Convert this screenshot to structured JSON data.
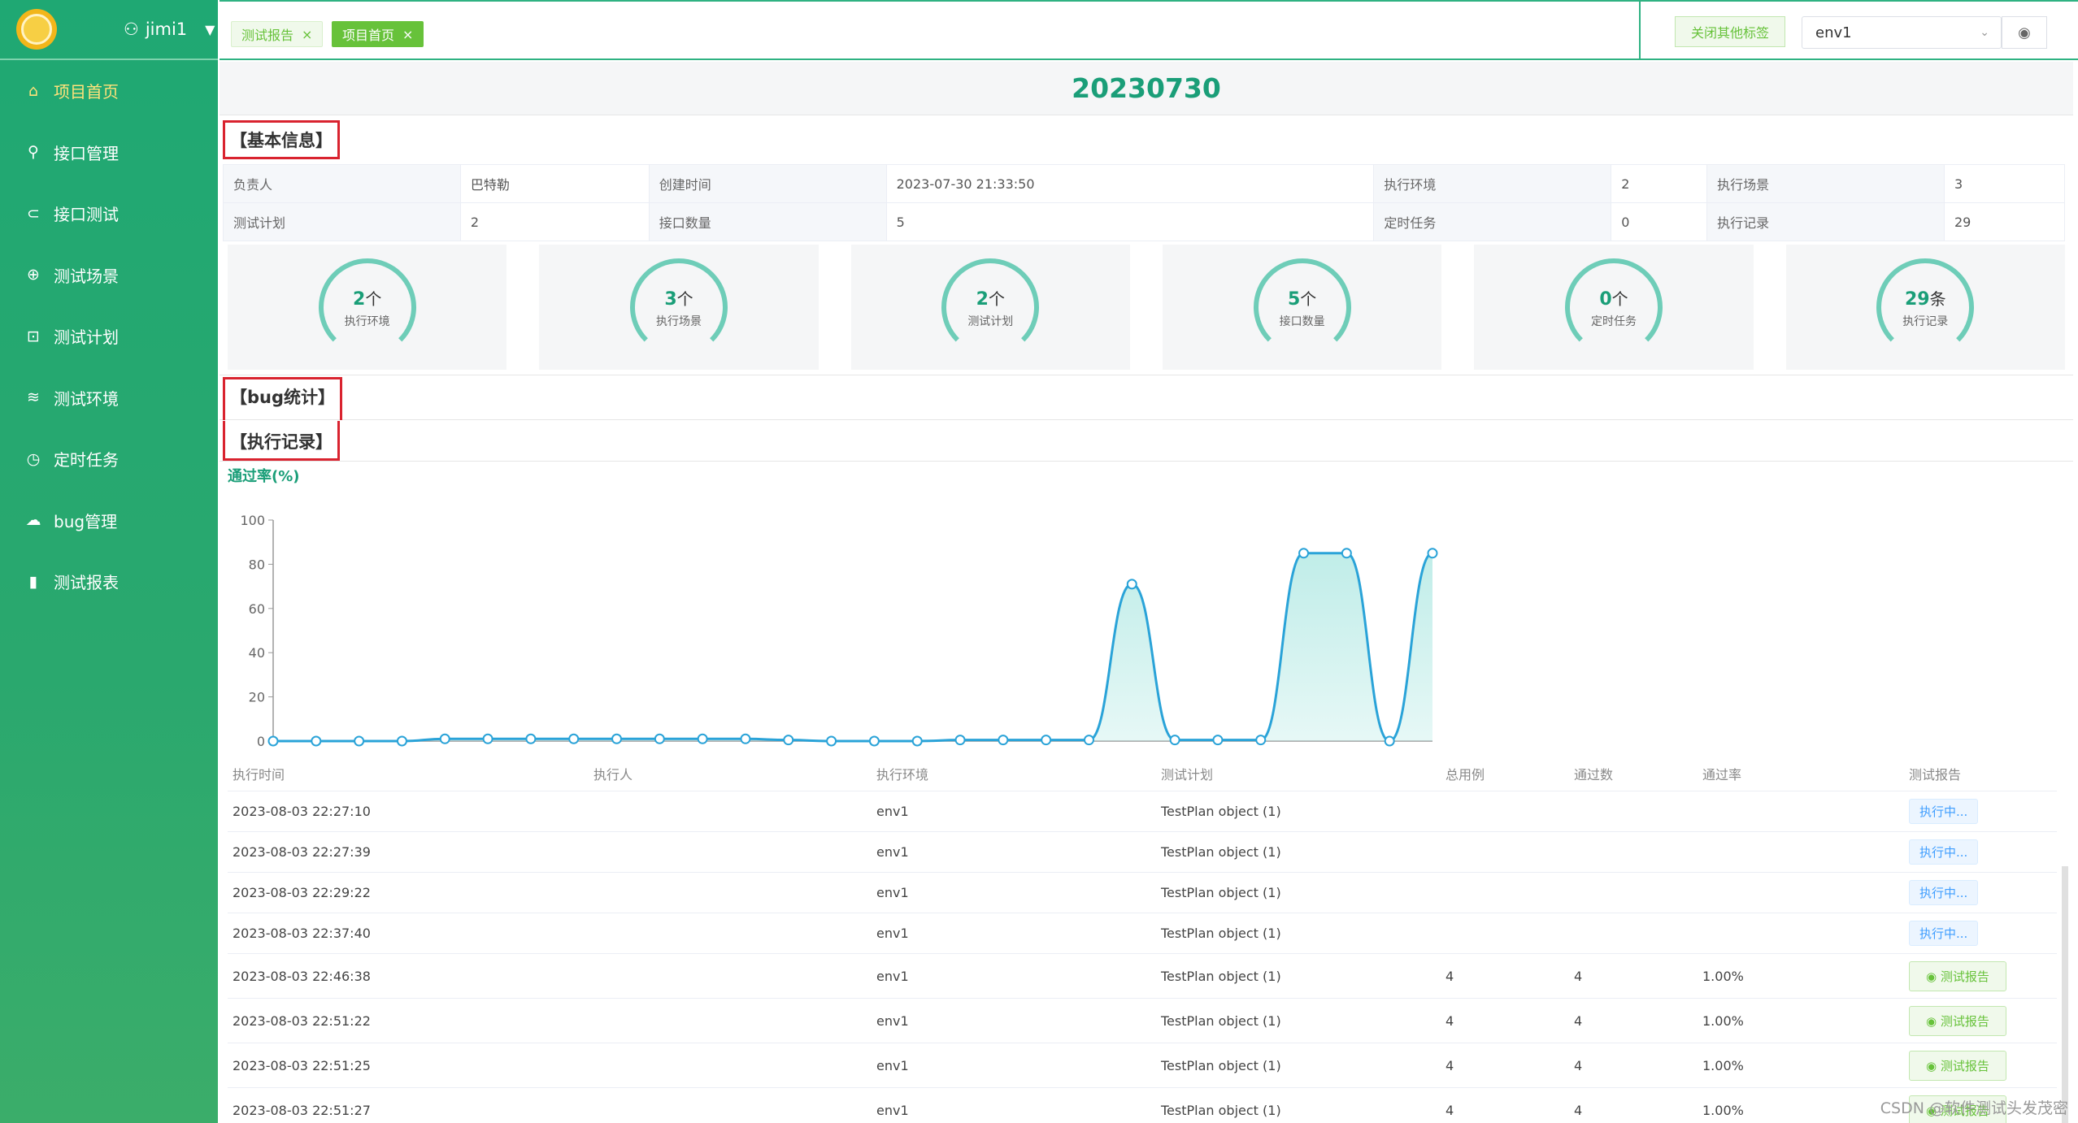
{
  "sidebar": {
    "user": "jimi1",
    "items": [
      {
        "label": "项目首页",
        "icon": "home-icon",
        "glyph": "⌂"
      },
      {
        "label": "接口管理",
        "icon": "paperclip-icon",
        "glyph": "⚲"
      },
      {
        "label": "接口测试",
        "icon": "link-icon",
        "glyph": "⊂"
      },
      {
        "label": "测试场景",
        "icon": "plus-circle-icon",
        "glyph": "⊕"
      },
      {
        "label": "测试计划",
        "icon": "bookmark-icon",
        "glyph": "⊡"
      },
      {
        "label": "测试环境",
        "icon": "database-icon",
        "glyph": "≋"
      },
      {
        "label": "定时任务",
        "icon": "clock-icon",
        "glyph": "◷"
      },
      {
        "label": "bug管理",
        "icon": "cloud-icon",
        "glyph": "☁"
      },
      {
        "label": "测试报表",
        "icon": "bar-chart-icon",
        "glyph": "▮"
      }
    ]
  },
  "tabs": [
    {
      "label": "测试报告",
      "close": "×"
    },
    {
      "label": "项目首页",
      "close": "×"
    }
  ],
  "topbar": {
    "close_others": "关闭其他标签",
    "env_value": "env1"
  },
  "page_title": "20230730",
  "basic_info": {
    "heading": "【基本信息】",
    "rows": [
      [
        {
          "label": "负责人",
          "value": "巴特勒"
        },
        {
          "label": "创建时间",
          "value": "2023-07-30 21:33:50"
        },
        {
          "label": "执行环境",
          "value": "2"
        },
        {
          "label": "执行场景",
          "value": "3"
        }
      ],
      [
        {
          "label": "测试计划",
          "value": "2"
        },
        {
          "label": "接口数量",
          "value": "5"
        },
        {
          "label": "定时任务",
          "value": "0"
        },
        {
          "label": "执行记录",
          "value": "29"
        }
      ]
    ]
  },
  "stats": [
    {
      "value": "2",
      "unit": "个",
      "label": "执行环境"
    },
    {
      "value": "3",
      "unit": "个",
      "label": "执行场景"
    },
    {
      "value": "2",
      "unit": "个",
      "label": "测试计划"
    },
    {
      "value": "5",
      "unit": "个",
      "label": "接口数量"
    },
    {
      "value": "0",
      "unit": "个",
      "label": "定时任务"
    },
    {
      "value": "29",
      "unit": "条",
      "label": "执行记录"
    }
  ],
  "bug_heading": "【bug统计】",
  "record_heading": "【执行记录】",
  "chart_data": {
    "type": "area",
    "title": "通过率(%)",
    "ylim": [
      0,
      100
    ],
    "yticks": [
      0,
      20,
      40,
      60,
      80,
      100
    ],
    "values": [
      0,
      0,
      0,
      0,
      1,
      1,
      1,
      1,
      1,
      1,
      1,
      1,
      0.5,
      0,
      0,
      0,
      0.5,
      0.5,
      0.5,
      0.5,
      71,
      0.5,
      0.5,
      0.5,
      85,
      85,
      0,
      85
    ],
    "color": "#2aa3d8",
    "fill": "#b9ebe6"
  },
  "records": {
    "columns": [
      "执行时间",
      "执行人",
      "执行环境",
      "测试计划",
      "总用例",
      "通过数",
      "通过率",
      "测试报告"
    ],
    "rows": [
      {
        "time": "2023-08-03 22:27:10",
        "user": "",
        "env": "env1",
        "plan": "TestPlan object (1)",
        "total": "",
        "pass": "",
        "rate": "",
        "report": "执行中..."
      },
      {
        "time": "2023-08-03 22:27:39",
        "user": "",
        "env": "env1",
        "plan": "TestPlan object (1)",
        "total": "",
        "pass": "",
        "rate": "",
        "report": "执行中..."
      },
      {
        "time": "2023-08-03 22:29:22",
        "user": "",
        "env": "env1",
        "plan": "TestPlan object (1)",
        "total": "",
        "pass": "",
        "rate": "",
        "report": "执行中..."
      },
      {
        "time": "2023-08-03 22:37:40",
        "user": "",
        "env": "env1",
        "plan": "TestPlan object (1)",
        "total": "",
        "pass": "",
        "rate": "",
        "report": "执行中..."
      },
      {
        "time": "2023-08-03 22:46:38",
        "user": "",
        "env": "env1",
        "plan": "TestPlan object (1)",
        "total": "4",
        "pass": "4",
        "rate": "1.00%",
        "report": "测试报告"
      },
      {
        "time": "2023-08-03 22:51:22",
        "user": "",
        "env": "env1",
        "plan": "TestPlan object (1)",
        "total": "4",
        "pass": "4",
        "rate": "1.00%",
        "report": "测试报告"
      },
      {
        "time": "2023-08-03 22:51:25",
        "user": "",
        "env": "env1",
        "plan": "TestPlan object (1)",
        "total": "4",
        "pass": "4",
        "rate": "1.00%",
        "report": "测试报告"
      },
      {
        "time": "2023-08-03 22:51:27",
        "user": "",
        "env": "env1",
        "plan": "TestPlan object (1)",
        "total": "4",
        "pass": "4",
        "rate": "1.00%",
        "report": "测试报告"
      }
    ]
  },
  "watermark": "CSDN @软件测试头发茂密"
}
